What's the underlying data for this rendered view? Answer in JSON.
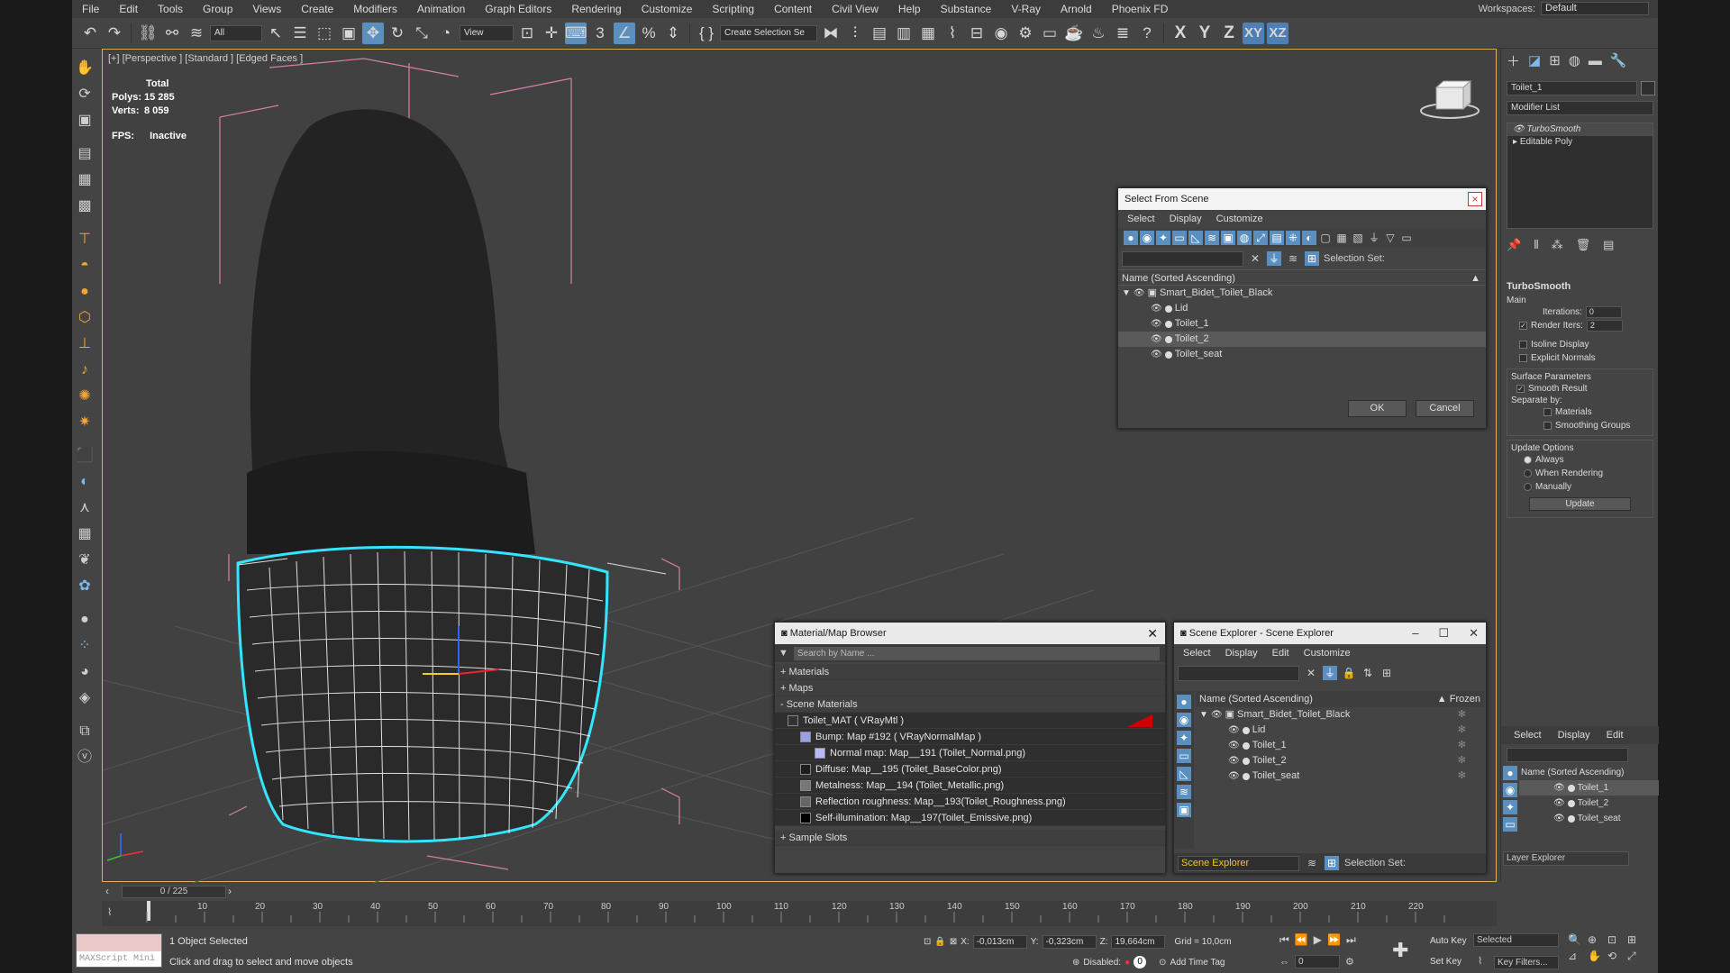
{
  "menu": [
    "File",
    "Edit",
    "Tools",
    "Group",
    "Views",
    "Create",
    "Modifiers",
    "Animation",
    "Graph Editors",
    "Rendering",
    "Customize",
    "Scripting",
    "Content",
    "Civil View",
    "Help",
    "Substance",
    "V-Ray",
    "Arnold",
    "Phoenix FD"
  ],
  "workspaces": {
    "label": "Workspaces:",
    "value": "Default"
  },
  "toolbar": {
    "filter": "All",
    "view": "View",
    "selection_set": "Create Selection Se",
    "axes": [
      "X",
      "Y",
      "Z",
      "XY",
      "XZ"
    ]
  },
  "viewport": {
    "label": "[+] [Perspective ] [Standard ] [Edged Faces ]",
    "stats_title": "Total",
    "polys_label": "Polys:",
    "polys": "15 285",
    "verts_label": "Verts:",
    "verts": "8 059",
    "fps_label": "FPS:",
    "fps": "Inactive"
  },
  "select_from_scene": {
    "title": "Select From Scene",
    "menu": [
      "Select",
      "Display",
      "Customize"
    ],
    "selection_set_label": "Selection Set:",
    "column": "Name (Sorted Ascending)",
    "root": "Smart_Bidet_Toilet_Black",
    "children": [
      "Lid",
      "Toilet_1",
      "Toilet_2",
      "Toilet_seat"
    ],
    "ok": "OK",
    "cancel": "Cancel"
  },
  "material_browser": {
    "title": "Material/Map Browser",
    "search_placeholder": "Search by Name ...",
    "sections": [
      "+ Materials",
      "+ Maps",
      "- Scene Materials"
    ],
    "items": [
      "Toilet_MAT  ( VRayMtl )",
      "Bump: Map #192  ( VRayNormalMap )",
      "Normal map: Map__191 (Toilet_Normal.png)",
      "Diffuse: Map__195 (Toilet_BaseColor.png)",
      "Metalness: Map__194 (Toilet_Metallic.png)",
      "Reflection roughness: Map__193(Toilet_Roughness.png)",
      "Self-illumination: Map__197(Toilet_Emissive.png)"
    ],
    "sample_slots": "+ Sample Slots"
  },
  "scene_explorer": {
    "title": "Scene Explorer - Scene Explorer",
    "menu": [
      "Select",
      "Display",
      "Edit",
      "Customize"
    ],
    "column": "Name (Sorted Ascending)",
    "frozen": "Frozen",
    "root": "Smart_Bidet_Toilet_Black",
    "children": [
      "Lid",
      "Toilet_1",
      "Toilet_2",
      "Toilet_seat"
    ],
    "footer_name": "Scene Explorer",
    "selection_set_label": "Selection Set:"
  },
  "command_panel": {
    "object_name": "Toilet_1",
    "modifier_list": "Modifier List",
    "stack": [
      "TurboSmooth",
      "Editable Poly"
    ],
    "rollout_title": "TurboSmooth",
    "main": "Main",
    "iterations_label": "Iterations:",
    "iterations": "0",
    "render_iters_label": "Render Iters:",
    "render_iters": "2",
    "isoline": "Isoline Display",
    "explicit_normals": "Explicit Normals",
    "surface_params": "Surface Parameters",
    "smooth_result": "Smooth Result",
    "separate_by": "Separate by:",
    "materials": "Materials",
    "smoothing_groups": "Smoothing Groups",
    "update_options": "Update Options",
    "always": "Always",
    "when_rendering": "When Rendering",
    "manually": "Manually",
    "update_btn": "Update"
  },
  "layer_explorer": {
    "menu": [
      "Select",
      "Display",
      "Edit"
    ],
    "column": "Name (Sorted Ascending)",
    "items": [
      "Toilet_1",
      "Toilet_2",
      "Toilet_seat"
    ],
    "footer": "Layer Explorer"
  },
  "timeline": {
    "slider": "0 / 225",
    "ticks": [
      "10",
      "20",
      "30",
      "40",
      "50",
      "60",
      "70",
      "80",
      "90",
      "100",
      "110",
      "120",
      "130",
      "140",
      "150",
      "160",
      "170",
      "180",
      "190",
      "200",
      "210",
      "220"
    ]
  },
  "status": {
    "maxscript": "MAXScript Mini",
    "selected": "1 Object Selected",
    "hint": "Click and drag to select and move objects",
    "x_label": "X:",
    "x": "-0,013cm",
    "y_label": "Y:",
    "y": "-0,323cm",
    "z_label": "Z:",
    "z": "19,664cm",
    "grid": "Grid = 10,0cm",
    "disabled": "Disabled:",
    "disabled_val": "0",
    "add_time_tag": "Add Time Tag",
    "auto_key": "Auto Key",
    "selected_dd": "Selected",
    "set_key": "Set Key",
    "key_filters": "Key Filters...",
    "frame": "0"
  }
}
